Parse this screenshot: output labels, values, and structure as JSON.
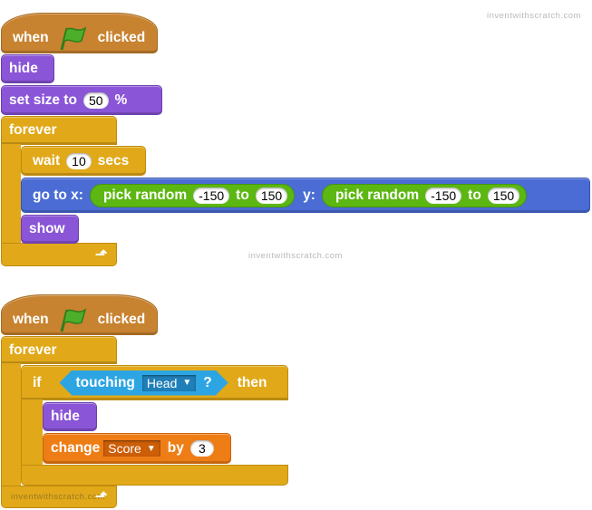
{
  "watermark": "inventwithscratch.com",
  "script1": {
    "hat": {
      "when": "when",
      "clicked": "clicked",
      "flag_icon": "green-flag-icon"
    },
    "hide": "hide",
    "set_size": {
      "label": "set size to",
      "value": "50",
      "unit": "%"
    },
    "forever": "forever",
    "wait": {
      "label": "wait",
      "value": "10",
      "unit": "secs"
    },
    "goto": {
      "label": "go to x:",
      "x_random": {
        "label": "pick random",
        "from": "-150",
        "to_label": "to",
        "to": "150"
      },
      "y_label": "y:",
      "y_random": {
        "label": "pick random",
        "from": "-150",
        "to_label": "to",
        "to": "150"
      }
    },
    "show": "show"
  },
  "script2": {
    "hat": {
      "when": "when",
      "clicked": "clicked",
      "flag_icon": "green-flag-icon"
    },
    "forever": "forever",
    "if": {
      "label": "if",
      "condition": {
        "label": "touching",
        "dropdown": "Head",
        "suffix": "?"
      },
      "then": "then"
    },
    "hide": "hide",
    "change": {
      "label": "change",
      "variable": "Score",
      "by_label": "by",
      "value": "3"
    }
  },
  "colors": {
    "events": "#c88330",
    "looks": "#8a55d7",
    "control": "#e1a91a",
    "motion": "#4a6cd4",
    "operators": "#5cb712",
    "data": "#ee7d16",
    "sensing": "#2ca5e2"
  }
}
